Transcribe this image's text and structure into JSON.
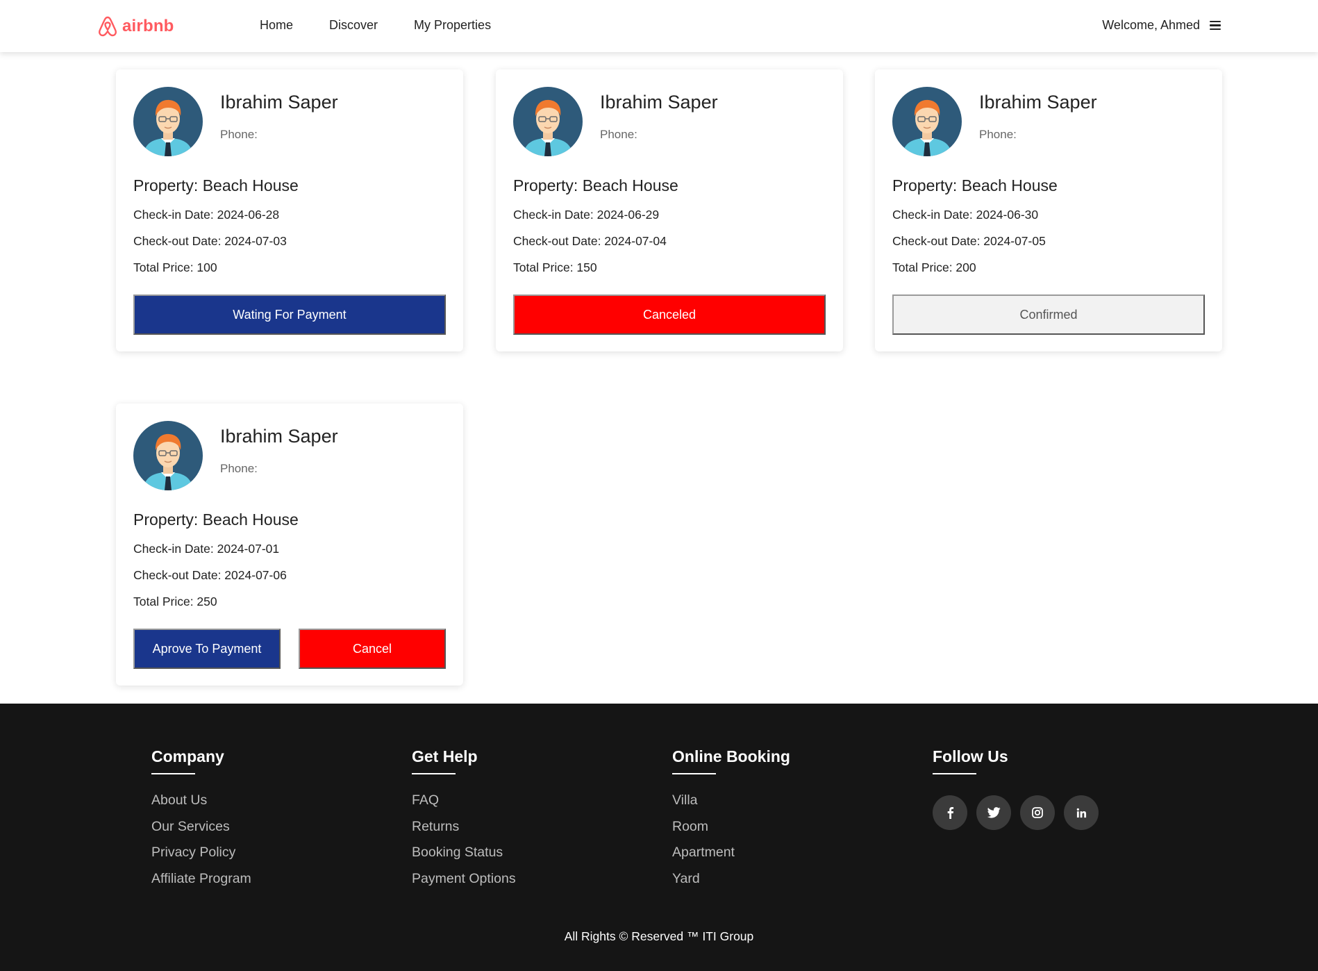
{
  "header": {
    "logo_text": "airbnb",
    "nav": [
      "Home",
      "Discover",
      "My Properties"
    ],
    "welcome": "Welcome, Ahmed"
  },
  "cards": [
    {
      "guest": "Ibrahim Saper",
      "phone": "Phone:",
      "property": "Property: Beach House",
      "checkin": "Check-in Date: 2024-06-28",
      "checkout": "Check-out Date: 2024-07-03",
      "price": "Total Price: 100",
      "status_button": "Wating For Payment"
    },
    {
      "guest": "Ibrahim Saper",
      "phone": "Phone:",
      "property": "Property: Beach House",
      "checkin": "Check-in Date: 2024-06-29",
      "checkout": "Check-out Date: 2024-07-04",
      "price": "Total Price: 150",
      "status_button": "Canceled"
    },
    {
      "guest": "Ibrahim Saper",
      "phone": "Phone:",
      "property": "Property: Beach House",
      "checkin": "Check-in Date: 2024-06-30",
      "checkout": "Check-out Date: 2024-07-05",
      "price": "Total Price: 200",
      "status_button": "Confirmed"
    },
    {
      "guest": "Ibrahim Saper",
      "phone": "Phone:",
      "property": "Property: Beach House",
      "checkin": "Check-in Date: 2024-07-01",
      "checkout": "Check-out Date: 2024-07-06",
      "price": "Total Price: 250",
      "approve_button": "Aprove To Payment",
      "cancel_button": "Cancel"
    }
  ],
  "colors": {
    "brand": "#ff5a5f",
    "primary_button": "#1a368c",
    "danger_button": "#ff0000",
    "neutral_button": "#f2f2f2",
    "footer_bg": "#151515"
  },
  "footer": {
    "company": {
      "title": "Company",
      "links": [
        "About Us",
        "Our Services",
        "Privacy Policy",
        "Affiliate Program"
      ]
    },
    "get_help": {
      "title": "Get Help",
      "links": [
        "FAQ",
        "Returns",
        "Booking Status",
        "Payment Options"
      ]
    },
    "online_booking": {
      "title": "Online Booking",
      "links": [
        "Villa",
        "Room",
        "Apartment",
        "Yard"
      ]
    },
    "follow_us": {
      "title": "Follow Us",
      "icons": [
        "facebook-icon",
        "twitter-icon",
        "instagram-icon",
        "linkedin-icon"
      ]
    },
    "copyright": "All Rights © Reserved ™ ITI Group"
  }
}
